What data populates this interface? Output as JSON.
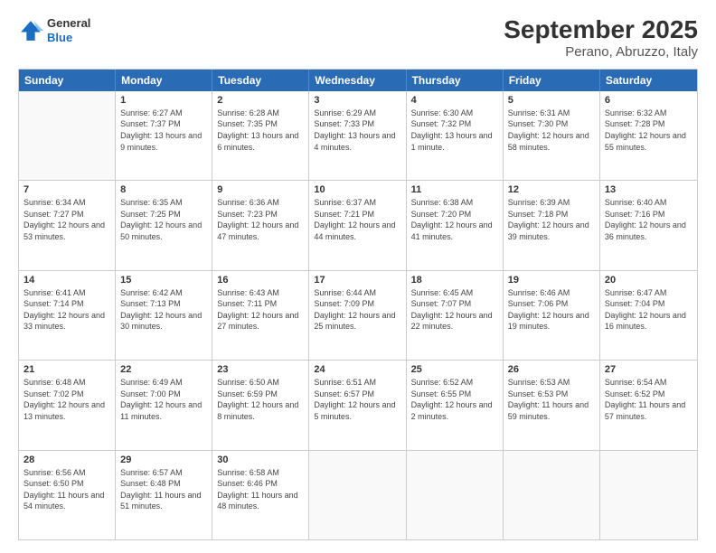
{
  "header": {
    "logo": {
      "general": "General",
      "blue": "Blue"
    },
    "title": "September 2025",
    "subtitle": "Perano, Abruzzo, Italy"
  },
  "days_of_week": [
    "Sunday",
    "Monday",
    "Tuesday",
    "Wednesday",
    "Thursday",
    "Friday",
    "Saturday"
  ],
  "weeks": [
    [
      {
        "day": "",
        "sunrise": "",
        "sunset": "",
        "daylight": ""
      },
      {
        "day": "1",
        "sunrise": "Sunrise: 6:27 AM",
        "sunset": "Sunset: 7:37 PM",
        "daylight": "Daylight: 13 hours and 9 minutes."
      },
      {
        "day": "2",
        "sunrise": "Sunrise: 6:28 AM",
        "sunset": "Sunset: 7:35 PM",
        "daylight": "Daylight: 13 hours and 6 minutes."
      },
      {
        "day": "3",
        "sunrise": "Sunrise: 6:29 AM",
        "sunset": "Sunset: 7:33 PM",
        "daylight": "Daylight: 13 hours and 4 minutes."
      },
      {
        "day": "4",
        "sunrise": "Sunrise: 6:30 AM",
        "sunset": "Sunset: 7:32 PM",
        "daylight": "Daylight: 13 hours and 1 minute."
      },
      {
        "day": "5",
        "sunrise": "Sunrise: 6:31 AM",
        "sunset": "Sunset: 7:30 PM",
        "daylight": "Daylight: 12 hours and 58 minutes."
      },
      {
        "day": "6",
        "sunrise": "Sunrise: 6:32 AM",
        "sunset": "Sunset: 7:28 PM",
        "daylight": "Daylight: 12 hours and 55 minutes."
      }
    ],
    [
      {
        "day": "7",
        "sunrise": "Sunrise: 6:34 AM",
        "sunset": "Sunset: 7:27 PM",
        "daylight": "Daylight: 12 hours and 53 minutes."
      },
      {
        "day": "8",
        "sunrise": "Sunrise: 6:35 AM",
        "sunset": "Sunset: 7:25 PM",
        "daylight": "Daylight: 12 hours and 50 minutes."
      },
      {
        "day": "9",
        "sunrise": "Sunrise: 6:36 AM",
        "sunset": "Sunset: 7:23 PM",
        "daylight": "Daylight: 12 hours and 47 minutes."
      },
      {
        "day": "10",
        "sunrise": "Sunrise: 6:37 AM",
        "sunset": "Sunset: 7:21 PM",
        "daylight": "Daylight: 12 hours and 44 minutes."
      },
      {
        "day": "11",
        "sunrise": "Sunrise: 6:38 AM",
        "sunset": "Sunset: 7:20 PM",
        "daylight": "Daylight: 12 hours and 41 minutes."
      },
      {
        "day": "12",
        "sunrise": "Sunrise: 6:39 AM",
        "sunset": "Sunset: 7:18 PM",
        "daylight": "Daylight: 12 hours and 39 minutes."
      },
      {
        "day": "13",
        "sunrise": "Sunrise: 6:40 AM",
        "sunset": "Sunset: 7:16 PM",
        "daylight": "Daylight: 12 hours and 36 minutes."
      }
    ],
    [
      {
        "day": "14",
        "sunrise": "Sunrise: 6:41 AM",
        "sunset": "Sunset: 7:14 PM",
        "daylight": "Daylight: 12 hours and 33 minutes."
      },
      {
        "day": "15",
        "sunrise": "Sunrise: 6:42 AM",
        "sunset": "Sunset: 7:13 PM",
        "daylight": "Daylight: 12 hours and 30 minutes."
      },
      {
        "day": "16",
        "sunrise": "Sunrise: 6:43 AM",
        "sunset": "Sunset: 7:11 PM",
        "daylight": "Daylight: 12 hours and 27 minutes."
      },
      {
        "day": "17",
        "sunrise": "Sunrise: 6:44 AM",
        "sunset": "Sunset: 7:09 PM",
        "daylight": "Daylight: 12 hours and 25 minutes."
      },
      {
        "day": "18",
        "sunrise": "Sunrise: 6:45 AM",
        "sunset": "Sunset: 7:07 PM",
        "daylight": "Daylight: 12 hours and 22 minutes."
      },
      {
        "day": "19",
        "sunrise": "Sunrise: 6:46 AM",
        "sunset": "Sunset: 7:06 PM",
        "daylight": "Daylight: 12 hours and 19 minutes."
      },
      {
        "day": "20",
        "sunrise": "Sunrise: 6:47 AM",
        "sunset": "Sunset: 7:04 PM",
        "daylight": "Daylight: 12 hours and 16 minutes."
      }
    ],
    [
      {
        "day": "21",
        "sunrise": "Sunrise: 6:48 AM",
        "sunset": "Sunset: 7:02 PM",
        "daylight": "Daylight: 12 hours and 13 minutes."
      },
      {
        "day": "22",
        "sunrise": "Sunrise: 6:49 AM",
        "sunset": "Sunset: 7:00 PM",
        "daylight": "Daylight: 12 hours and 11 minutes."
      },
      {
        "day": "23",
        "sunrise": "Sunrise: 6:50 AM",
        "sunset": "Sunset: 6:59 PM",
        "daylight": "Daylight: 12 hours and 8 minutes."
      },
      {
        "day": "24",
        "sunrise": "Sunrise: 6:51 AM",
        "sunset": "Sunset: 6:57 PM",
        "daylight": "Daylight: 12 hours and 5 minutes."
      },
      {
        "day": "25",
        "sunrise": "Sunrise: 6:52 AM",
        "sunset": "Sunset: 6:55 PM",
        "daylight": "Daylight: 12 hours and 2 minutes."
      },
      {
        "day": "26",
        "sunrise": "Sunrise: 6:53 AM",
        "sunset": "Sunset: 6:53 PM",
        "daylight": "Daylight: 11 hours and 59 minutes."
      },
      {
        "day": "27",
        "sunrise": "Sunrise: 6:54 AM",
        "sunset": "Sunset: 6:52 PM",
        "daylight": "Daylight: 11 hours and 57 minutes."
      }
    ],
    [
      {
        "day": "28",
        "sunrise": "Sunrise: 6:56 AM",
        "sunset": "Sunset: 6:50 PM",
        "daylight": "Daylight: 11 hours and 54 minutes."
      },
      {
        "day": "29",
        "sunrise": "Sunrise: 6:57 AM",
        "sunset": "Sunset: 6:48 PM",
        "daylight": "Daylight: 11 hours and 51 minutes."
      },
      {
        "day": "30",
        "sunrise": "Sunrise: 6:58 AM",
        "sunset": "Sunset: 6:46 PM",
        "daylight": "Daylight: 11 hours and 48 minutes."
      },
      {
        "day": "",
        "sunrise": "",
        "sunset": "",
        "daylight": ""
      },
      {
        "day": "",
        "sunrise": "",
        "sunset": "",
        "daylight": ""
      },
      {
        "day": "",
        "sunrise": "",
        "sunset": "",
        "daylight": ""
      },
      {
        "day": "",
        "sunrise": "",
        "sunset": "",
        "daylight": ""
      }
    ]
  ]
}
